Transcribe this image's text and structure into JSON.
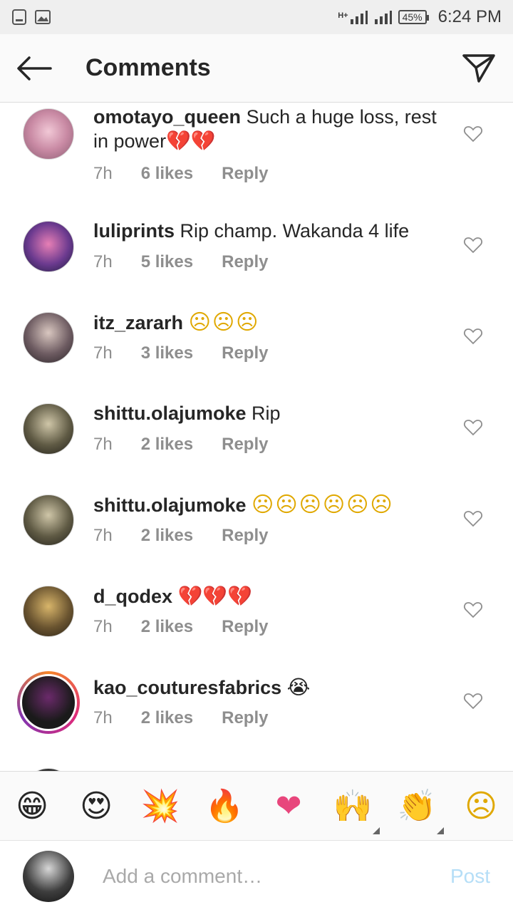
{
  "status": {
    "signal_label": "H+",
    "battery": "45%",
    "time": "6:24 PM"
  },
  "header": {
    "title": "Comments"
  },
  "comments": [
    {
      "username": "omotayo_queen",
      "text": "Such a huge loss, rest in power",
      "emoji": "💔💔",
      "time": "7h",
      "likes": "6 likes",
      "reply": "Reply"
    },
    {
      "username": "luliprints",
      "text": "Rip champ. Wakanda 4 life",
      "emoji": "",
      "time": "7h",
      "likes": "5 likes",
      "reply": "Reply"
    },
    {
      "username": "itz_zararh",
      "text": "",
      "emoji": "☹☹☹",
      "time": "7h",
      "likes": "3 likes",
      "reply": "Reply"
    },
    {
      "username": "shittu.olajumoke",
      "text": "Rip",
      "emoji": "",
      "time": "7h",
      "likes": "2 likes",
      "reply": "Reply"
    },
    {
      "username": "shittu.olajumoke",
      "text": "",
      "emoji": "☹☹☹☹☹☹",
      "time": "7h",
      "likes": "2 likes",
      "reply": "Reply"
    },
    {
      "username": "d_qodex",
      "text": "",
      "emoji": "💔💔💔",
      "time": "7h",
      "likes": "2 likes",
      "reply": "Reply"
    },
    {
      "username": "kao_couturesfabrics",
      "text": "",
      "emoji": "😭",
      "time": "7h",
      "likes": "2 likes",
      "reply": "Reply"
    }
  ],
  "emoji_bar": [
    {
      "glyph": "😁",
      "name": "grinning-face-icon"
    },
    {
      "glyph": "😍",
      "name": "heart-eyes-icon"
    },
    {
      "glyph": "💥",
      "name": "collision-icon"
    },
    {
      "glyph": "🔥",
      "name": "fire-icon"
    },
    {
      "glyph": "❤",
      "name": "heart-icon"
    },
    {
      "glyph": "🙌",
      "name": "raising-hands-icon"
    },
    {
      "glyph": "👏",
      "name": "clapping-hands-icon"
    },
    {
      "glyph": "☹",
      "name": "frowning-face-icon"
    }
  ],
  "composer": {
    "placeholder": "Add a comment…",
    "post_label": "Post"
  },
  "colors": {
    "link_blue_disabled": "#b5def7",
    "meta_gray": "#8e8e8e",
    "broken_heart": "#d6336c"
  }
}
